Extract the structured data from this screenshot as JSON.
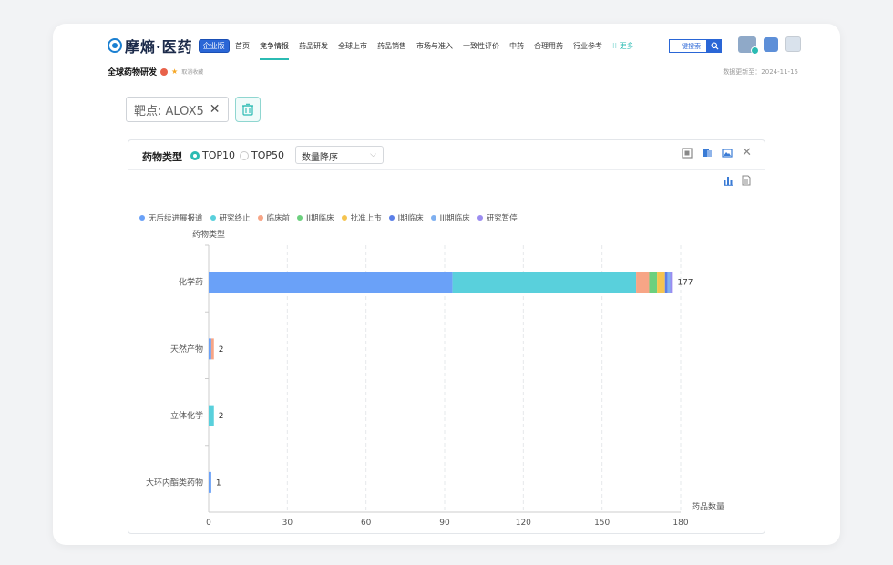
{
  "header": {
    "logo_text": "摩熵·医药",
    "logo_badge": "企业版",
    "nav": [
      "首页",
      "竞争情报",
      "药品研发",
      "全球上市",
      "药品销售",
      "市场与准入",
      "一致性评价",
      "中药",
      "合理用药",
      "行业参考",
      "更多"
    ],
    "nav_active": "竞争情报",
    "search_label": "一键搜索",
    "page_title": "全球药物研发",
    "unsubscribe": "取消收藏",
    "update_text": "数据更新至：2024-11-15"
  },
  "filter": {
    "chip_label": "靶点: ALOX5",
    "chip_close": "✕"
  },
  "panel": {
    "title": "药物类型",
    "radio_top10": "TOP10",
    "radio_top50": "TOP50",
    "sort_select": "数量降序",
    "close_glyph": "✕"
  },
  "chart_data": {
    "type": "bar",
    "orientation": "horizontal",
    "stacked": true,
    "ylabel": "药物类型",
    "xlabel": "药品数量",
    "xlim": [
      0,
      180
    ],
    "xticks": [
      0,
      30,
      60,
      90,
      120,
      150,
      180
    ],
    "categories": [
      "化学药",
      "天然产物",
      "立体化学",
      "大环内酯类药物"
    ],
    "totals": [
      177,
      2,
      2,
      1
    ],
    "legend_position": "top-left",
    "series": [
      {
        "name": "无后续进展报道",
        "color": "#6aa1f8",
        "values": [
          93,
          1,
          0,
          1
        ]
      },
      {
        "name": "研究终止",
        "color": "#59d0dc",
        "values": [
          70,
          0,
          2,
          0
        ]
      },
      {
        "name": "临床前",
        "color": "#f7a586",
        "values": [
          5,
          1,
          0,
          0
        ]
      },
      {
        "name": "II期临床",
        "color": "#6cd07e",
        "values": [
          3,
          0,
          0,
          0
        ]
      },
      {
        "name": "批准上市",
        "color": "#f5c44f",
        "values": [
          3,
          0,
          0,
          0
        ]
      },
      {
        "name": "I期临床",
        "color": "#5b7fe8",
        "values": [
          1,
          0,
          0,
          0
        ]
      },
      {
        "name": "III期临床",
        "color": "#7fb0f0",
        "values": [
          1,
          0,
          0,
          0
        ]
      },
      {
        "name": "研究暂停",
        "color": "#9b8cf0",
        "values": [
          1,
          0,
          0,
          0
        ]
      }
    ]
  }
}
